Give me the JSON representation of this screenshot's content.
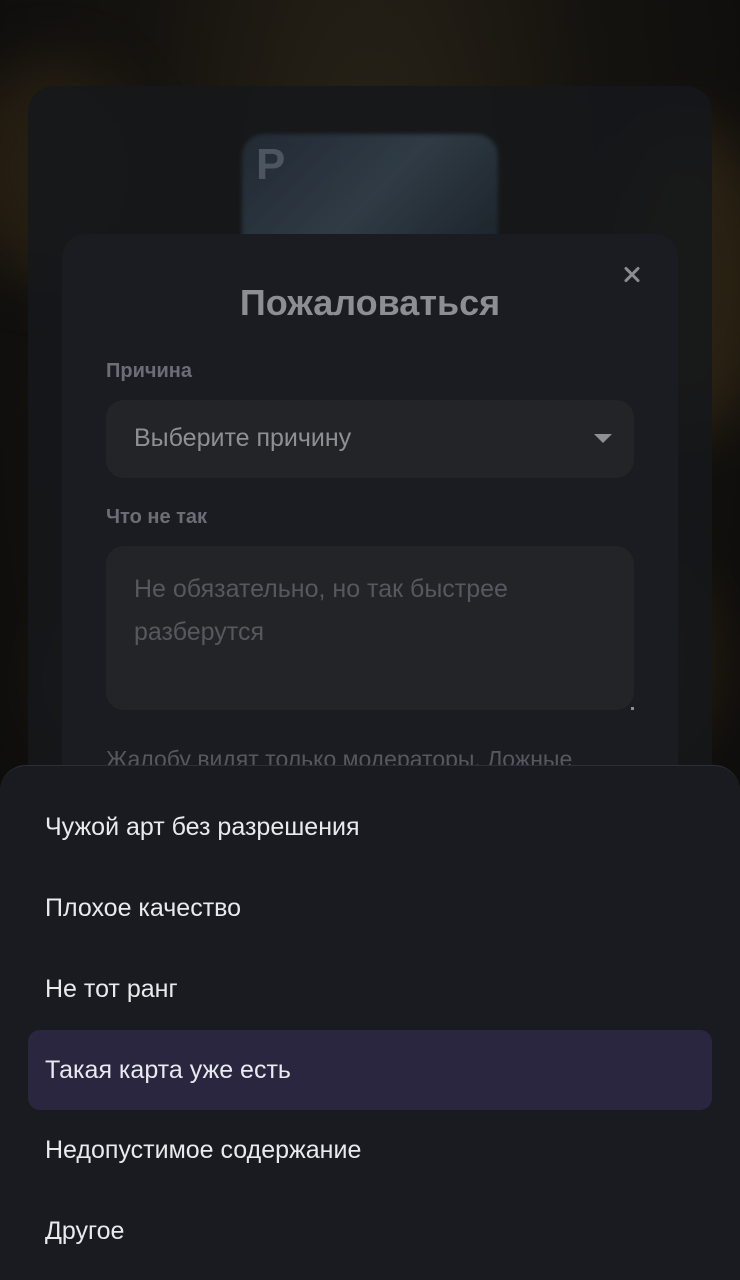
{
  "modal": {
    "title": "Пожаловаться",
    "reason_label": "Причина",
    "reason_select_value": "Выберите причину",
    "details_label": "Что не так",
    "details_placeholder": "Не обязательно, но так быстрее разберутся",
    "note": "Жалобу видят только модераторы. Ложные"
  },
  "sheet": {
    "options": [
      {
        "label": "Чужой арт без разрешения",
        "selected": false
      },
      {
        "label": "Плохое качество",
        "selected": false
      },
      {
        "label": "Не тот ранг",
        "selected": false
      },
      {
        "label": "Такая карта уже есть",
        "selected": true
      },
      {
        "label": "Недопустимое содержание",
        "selected": false
      },
      {
        "label": "Другое",
        "selected": false
      }
    ]
  },
  "background": {
    "card_letter": "P"
  },
  "colors": {
    "sheet_background": "#191b21",
    "selected_option": "#2a2640",
    "modal_background": "#1a1c21"
  }
}
